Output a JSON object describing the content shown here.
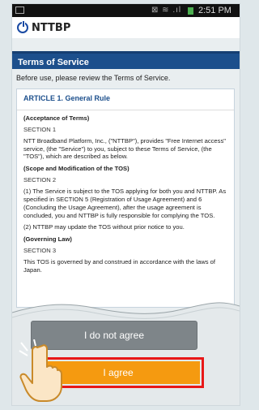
{
  "status_bar": {
    "time": "2:51 PM",
    "icons": "⊠ ≋ .ıl"
  },
  "app": {
    "logo_text": "NTTBP"
  },
  "page": {
    "title": "Terms of Service",
    "intro": "Before use, please review the Terms of Service."
  },
  "terms": {
    "article_title": "ARTICLE 1. General Rule",
    "sections": [
      {
        "heading": "(Acceptance of Terms)",
        "label": "SECTION 1",
        "paragraphs": [
          "NTT Broadband Platform, Inc., (\"NTTBP\"), provides \"Free Internet access\" service, (the \"Service\") to you, subject to these Terms of Service, (the \"TOS\"), which are described as below."
        ]
      },
      {
        "heading": "(Scope and Modification of the TOS)",
        "label": "SECTION 2",
        "paragraphs": [
          "(1) The Service is subject to the TOS applying for both you and NTTBP.  As specified in SECTION 5 (Registration of Usage Agreement) and 6 (Concluding the Usage Agreement), after the usage agreement is concluded, you and NTTBP is fully responsible for complying the TOS.",
          "(2) NTTBP may update the TOS without prior notice to you."
        ]
      },
      {
        "heading": "(Governing Law)",
        "label": "SECTION 3",
        "paragraphs": [
          "This TOS is governed by and construed in accordance with the laws of Japan."
        ]
      }
    ]
  },
  "buttons": {
    "disagree_label": "I do not agree",
    "agree_label": "I agree"
  },
  "colors": {
    "header_blue": "#1c4f8c",
    "agree_orange": "#f59a10",
    "highlight_red": "#e81818",
    "disagree_gray": "#7e8589"
  }
}
